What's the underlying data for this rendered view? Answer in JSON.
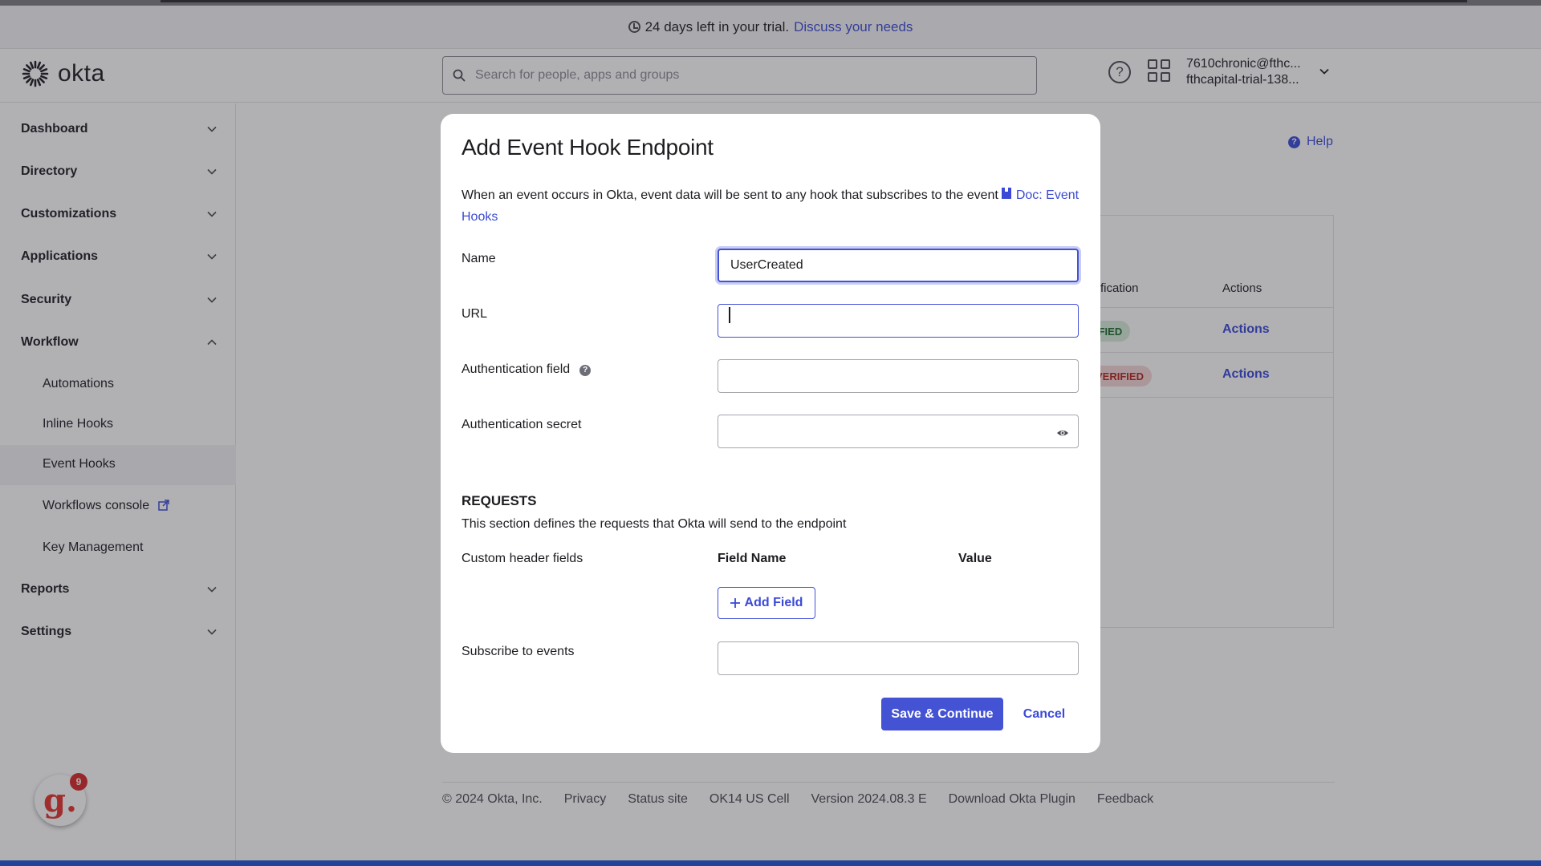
{
  "trial_banner": {
    "text": "24 days left in your trial.",
    "link": "Discuss your needs"
  },
  "header": {
    "brand": "okta",
    "search_placeholder": "Search for people, apps and groups",
    "help_icon": "help-circle-icon",
    "apps_icon": "app-grid-icon",
    "user_email": "7610chronic@fthc...",
    "user_org": "fthcapital-trial-138..."
  },
  "sidebar": {
    "items": [
      {
        "label": "Dashboard",
        "expanded": false
      },
      {
        "label": "Directory",
        "expanded": false
      },
      {
        "label": "Customizations",
        "expanded": false
      },
      {
        "label": "Applications",
        "expanded": false
      },
      {
        "label": "Security",
        "expanded": false
      },
      {
        "label": "Workflow",
        "expanded": true
      },
      {
        "label": "Reports",
        "expanded": false
      },
      {
        "label": "Settings",
        "expanded": false
      }
    ],
    "workflow_children": [
      "Automations",
      "Inline Hooks",
      "Event Hooks",
      "Workflows console",
      "Key Management"
    ],
    "active_child": "Event Hooks"
  },
  "background": {
    "help": "Help",
    "table_headers": [
      "fication",
      "Actions"
    ],
    "rows": [
      {
        "status": "IFIED",
        "status_kind": "verified",
        "action": "Actions"
      },
      {
        "status": "VERIFIED",
        "status_kind": "unverified",
        "action": "Actions"
      }
    ],
    "footer": [
      "© 2024 Okta, Inc.",
      "Privacy",
      "Status site",
      "OK14 US Cell",
      "Version 2024.08.3 E",
      "Download Okta Plugin",
      "Feedback"
    ]
  },
  "widget": {
    "letter": "g.",
    "count": "9"
  },
  "modal": {
    "title": "Add Event Hook Endpoint",
    "description": "When an event occurs in Okta, event data will be sent to any hook that subscribes to the event",
    "doc_link": "Doc: Event Hooks",
    "fields": {
      "name_label": "Name",
      "name_value": "UserCreated",
      "url_label": "URL",
      "url_value": "",
      "auth_field_label": "Authentication field",
      "auth_field_value": "",
      "auth_secret_label": "Authentication secret",
      "auth_secret_value": ""
    },
    "requests": {
      "heading": "REQUESTS",
      "description": "This section defines the requests that Okta will send to the endpoint",
      "custom_header_label": "Custom header fields",
      "field_name_header": "Field Name",
      "value_header": "Value",
      "add_field_label": "Add Field"
    },
    "subscribe_label": "Subscribe to events",
    "subscribe_value": "",
    "save_label": "Save & Continue",
    "cancel_label": "Cancel"
  },
  "colors": {
    "accent": "#4452d4",
    "link": "#3b4ad6",
    "verified": "#1c6b2e",
    "unverified": "#b3261e"
  }
}
